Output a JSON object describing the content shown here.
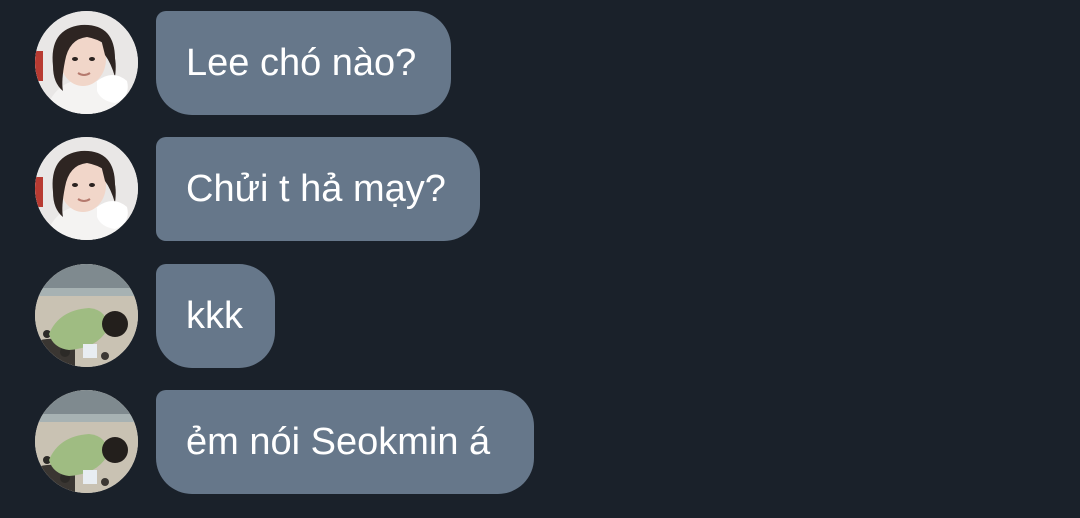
{
  "chat": {
    "messages": [
      {
        "sender_avatar": "avatar-girl-photo",
        "text": "Lee chó nào?"
      },
      {
        "sender_avatar": "avatar-girl-photo",
        "text": "Chửi t hả mạy?"
      },
      {
        "sender_avatar": "avatar-beach-photo",
        "text": "kkk"
      },
      {
        "sender_avatar": "avatar-beach-photo",
        "text": "ẻm nói Seokmin á"
      }
    ]
  },
  "colors": {
    "background": "#1a212a",
    "bubble": "#66778a",
    "text": "#ffffff"
  }
}
